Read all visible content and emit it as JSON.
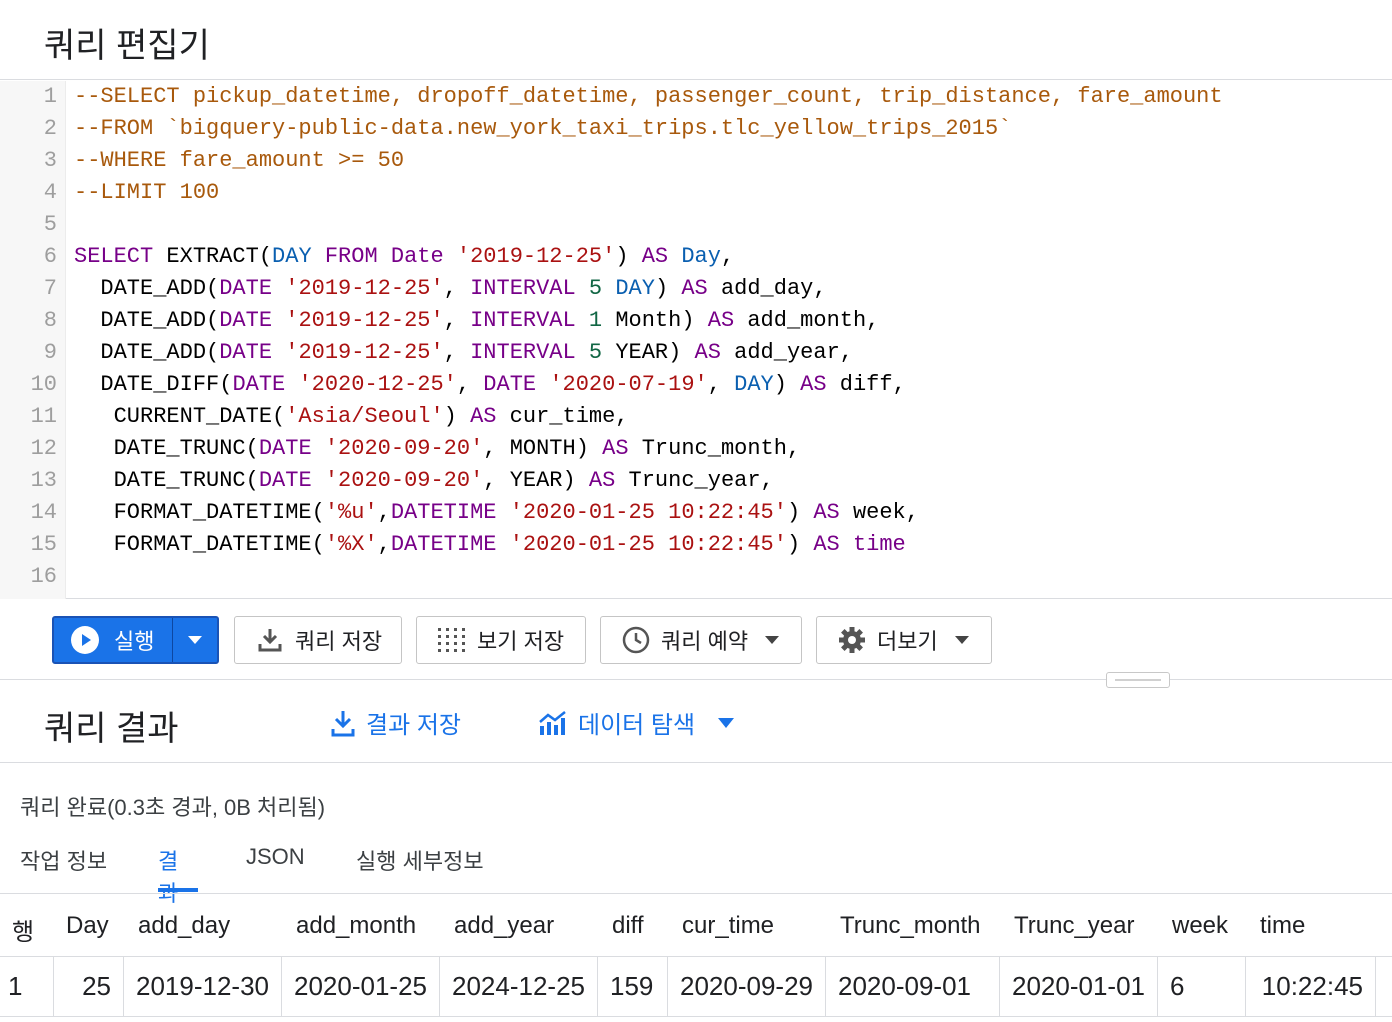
{
  "editor": {
    "title": "쿼리 편집기",
    "lines": [
      {
        "num": "1",
        "tokens": [
          {
            "t": "--SELECT pickup_datetime, dropoff_datetime, passenger_count, trip_distance, fare_amount",
            "c": "comment"
          }
        ]
      },
      {
        "num": "2",
        "tokens": [
          {
            "t": "--FROM `bigquery-public-data.new_york_taxi_trips.tlc_yellow_trips_2015`",
            "c": "comment"
          }
        ]
      },
      {
        "num": "3",
        "tokens": [
          {
            "t": "--WHERE fare_amount >= 50",
            "c": "comment"
          }
        ]
      },
      {
        "num": "4",
        "tokens": [
          {
            "t": "--LIMIT 100",
            "c": "comment"
          }
        ]
      },
      {
        "num": "5",
        "tokens": []
      },
      {
        "num": "6",
        "tokens": [
          {
            "t": "SELECT",
            "c": "keyword"
          },
          {
            "t": " EXTRACT(",
            "c": "plain"
          },
          {
            "t": "DAY",
            "c": "type"
          },
          {
            "t": " ",
            "c": "plain"
          },
          {
            "t": "FROM",
            "c": "keyword"
          },
          {
            "t": " ",
            "c": "plain"
          },
          {
            "t": "Date",
            "c": "keyword"
          },
          {
            "t": " ",
            "c": "plain"
          },
          {
            "t": "'2019-12-25'",
            "c": "string"
          },
          {
            "t": ") ",
            "c": "plain"
          },
          {
            "t": "AS",
            "c": "keyword"
          },
          {
            "t": " ",
            "c": "plain"
          },
          {
            "t": "Day",
            "c": "type"
          },
          {
            "t": ",",
            "c": "plain"
          }
        ]
      },
      {
        "num": "7",
        "tokens": [
          {
            "t": "  DATE_ADD(",
            "c": "plain"
          },
          {
            "t": "DATE",
            "c": "keyword"
          },
          {
            "t": " ",
            "c": "plain"
          },
          {
            "t": "'2019-12-25'",
            "c": "string"
          },
          {
            "t": ", ",
            "c": "plain"
          },
          {
            "t": "INTERVAL",
            "c": "keyword"
          },
          {
            "t": " ",
            "c": "plain"
          },
          {
            "t": "5",
            "c": "number"
          },
          {
            "t": " ",
            "c": "plain"
          },
          {
            "t": "DAY",
            "c": "type"
          },
          {
            "t": ") ",
            "c": "plain"
          },
          {
            "t": "AS",
            "c": "keyword"
          },
          {
            "t": " add_day,",
            "c": "plain"
          }
        ]
      },
      {
        "num": "8",
        "tokens": [
          {
            "t": "  DATE_ADD(",
            "c": "plain"
          },
          {
            "t": "DATE",
            "c": "keyword"
          },
          {
            "t": " ",
            "c": "plain"
          },
          {
            "t": "'2019-12-25'",
            "c": "string"
          },
          {
            "t": ", ",
            "c": "plain"
          },
          {
            "t": "INTERVAL",
            "c": "keyword"
          },
          {
            "t": " ",
            "c": "plain"
          },
          {
            "t": "1",
            "c": "number"
          },
          {
            "t": " Month) ",
            "c": "plain"
          },
          {
            "t": "AS",
            "c": "keyword"
          },
          {
            "t": " add_month,",
            "c": "plain"
          }
        ]
      },
      {
        "num": "9",
        "tokens": [
          {
            "t": "  DATE_ADD(",
            "c": "plain"
          },
          {
            "t": "DATE",
            "c": "keyword"
          },
          {
            "t": " ",
            "c": "plain"
          },
          {
            "t": "'2019-12-25'",
            "c": "string"
          },
          {
            "t": ", ",
            "c": "plain"
          },
          {
            "t": "INTERVAL",
            "c": "keyword"
          },
          {
            "t": " ",
            "c": "plain"
          },
          {
            "t": "5",
            "c": "number"
          },
          {
            "t": " YEAR) ",
            "c": "plain"
          },
          {
            "t": "AS",
            "c": "keyword"
          },
          {
            "t": " add_year,",
            "c": "plain"
          }
        ]
      },
      {
        "num": "10",
        "tokens": [
          {
            "t": "  DATE_DIFF(",
            "c": "plain"
          },
          {
            "t": "DATE",
            "c": "keyword"
          },
          {
            "t": " ",
            "c": "plain"
          },
          {
            "t": "'2020-12-25'",
            "c": "string"
          },
          {
            "t": ", ",
            "c": "plain"
          },
          {
            "t": "DATE",
            "c": "keyword"
          },
          {
            "t": " ",
            "c": "plain"
          },
          {
            "t": "'2020-07-19'",
            "c": "string"
          },
          {
            "t": ", ",
            "c": "plain"
          },
          {
            "t": "DAY",
            "c": "type"
          },
          {
            "t": ") ",
            "c": "plain"
          },
          {
            "t": "AS",
            "c": "keyword"
          },
          {
            "t": " diff,",
            "c": "plain"
          }
        ]
      },
      {
        "num": "11",
        "tokens": [
          {
            "t": "   CURRENT_DATE(",
            "c": "plain"
          },
          {
            "t": "'Asia/Seoul'",
            "c": "string"
          },
          {
            "t": ") ",
            "c": "plain"
          },
          {
            "t": "AS",
            "c": "keyword"
          },
          {
            "t": " cur_time,",
            "c": "plain"
          }
        ]
      },
      {
        "num": "12",
        "tokens": [
          {
            "t": "   DATE_TRUNC(",
            "c": "plain"
          },
          {
            "t": "DATE",
            "c": "keyword"
          },
          {
            "t": " ",
            "c": "plain"
          },
          {
            "t": "'2020-09-20'",
            "c": "string"
          },
          {
            "t": ", MONTH) ",
            "c": "plain"
          },
          {
            "t": "AS",
            "c": "keyword"
          },
          {
            "t": " Trunc_month,",
            "c": "plain"
          }
        ]
      },
      {
        "num": "13",
        "tokens": [
          {
            "t": "   DATE_TRUNC(",
            "c": "plain"
          },
          {
            "t": "DATE",
            "c": "keyword"
          },
          {
            "t": " ",
            "c": "plain"
          },
          {
            "t": "'2020-09-20'",
            "c": "string"
          },
          {
            "t": ", YEAR) ",
            "c": "plain"
          },
          {
            "t": "AS",
            "c": "keyword"
          },
          {
            "t": " Trunc_year,",
            "c": "plain"
          }
        ]
      },
      {
        "num": "14",
        "tokens": [
          {
            "t": "   FORMAT_DATETIME(",
            "c": "plain"
          },
          {
            "t": "'%u'",
            "c": "string"
          },
          {
            "t": ",",
            "c": "plain"
          },
          {
            "t": "DATETIME",
            "c": "keyword"
          },
          {
            "t": " ",
            "c": "plain"
          },
          {
            "t": "'2020-01-25 10:22:45'",
            "c": "string"
          },
          {
            "t": ") ",
            "c": "plain"
          },
          {
            "t": "AS",
            "c": "keyword"
          },
          {
            "t": " week,",
            "c": "plain"
          }
        ]
      },
      {
        "num": "15",
        "tokens": [
          {
            "t": "   FORMAT_DATETIME(",
            "c": "plain"
          },
          {
            "t": "'%X'",
            "c": "string"
          },
          {
            "t": ",",
            "c": "plain"
          },
          {
            "t": "DATETIME",
            "c": "keyword"
          },
          {
            "t": " ",
            "c": "plain"
          },
          {
            "t": "'2020-01-25 10:22:45'",
            "c": "string"
          },
          {
            "t": ") ",
            "c": "plain"
          },
          {
            "t": "AS",
            "c": "keyword"
          },
          {
            "t": " ",
            "c": "plain"
          },
          {
            "t": "time",
            "c": "keyword"
          }
        ]
      },
      {
        "num": "16",
        "tokens": []
      }
    ]
  },
  "toolbar": {
    "run_label": "실행",
    "save_query_label": "쿼리 저장",
    "save_view_label": "보기 저장",
    "schedule_label": "쿼리 예약",
    "more_label": "더보기"
  },
  "results": {
    "title": "쿼리 결과",
    "save_results_label": "결과 저장",
    "explore_label": "데이터 탐색",
    "status": "쿼리 완료(0.3초 경과, 0B 처리됨)",
    "tabs": [
      "작업 정보",
      "결과",
      "JSON",
      "실행 세부정보"
    ],
    "active_tab": "결과",
    "columns": [
      "행",
      "Day",
      "add_day",
      "add_month",
      "add_year",
      "diff",
      "cur_time",
      "Trunc_month",
      "Trunc_year",
      "week",
      "time"
    ],
    "rows": [
      [
        "1",
        "25",
        "2019-12-30",
        "2020-01-25",
        "2024-12-25",
        "159",
        "2020-09-29",
        "2020-09-01",
        "2020-01-01",
        "6",
        "10:22:45"
      ]
    ]
  },
  "colors": {
    "accent": "#1a73e8",
    "comment": "#a8590c",
    "keyword": "#770088",
    "string": "#aa1111",
    "number": "#116644"
  }
}
